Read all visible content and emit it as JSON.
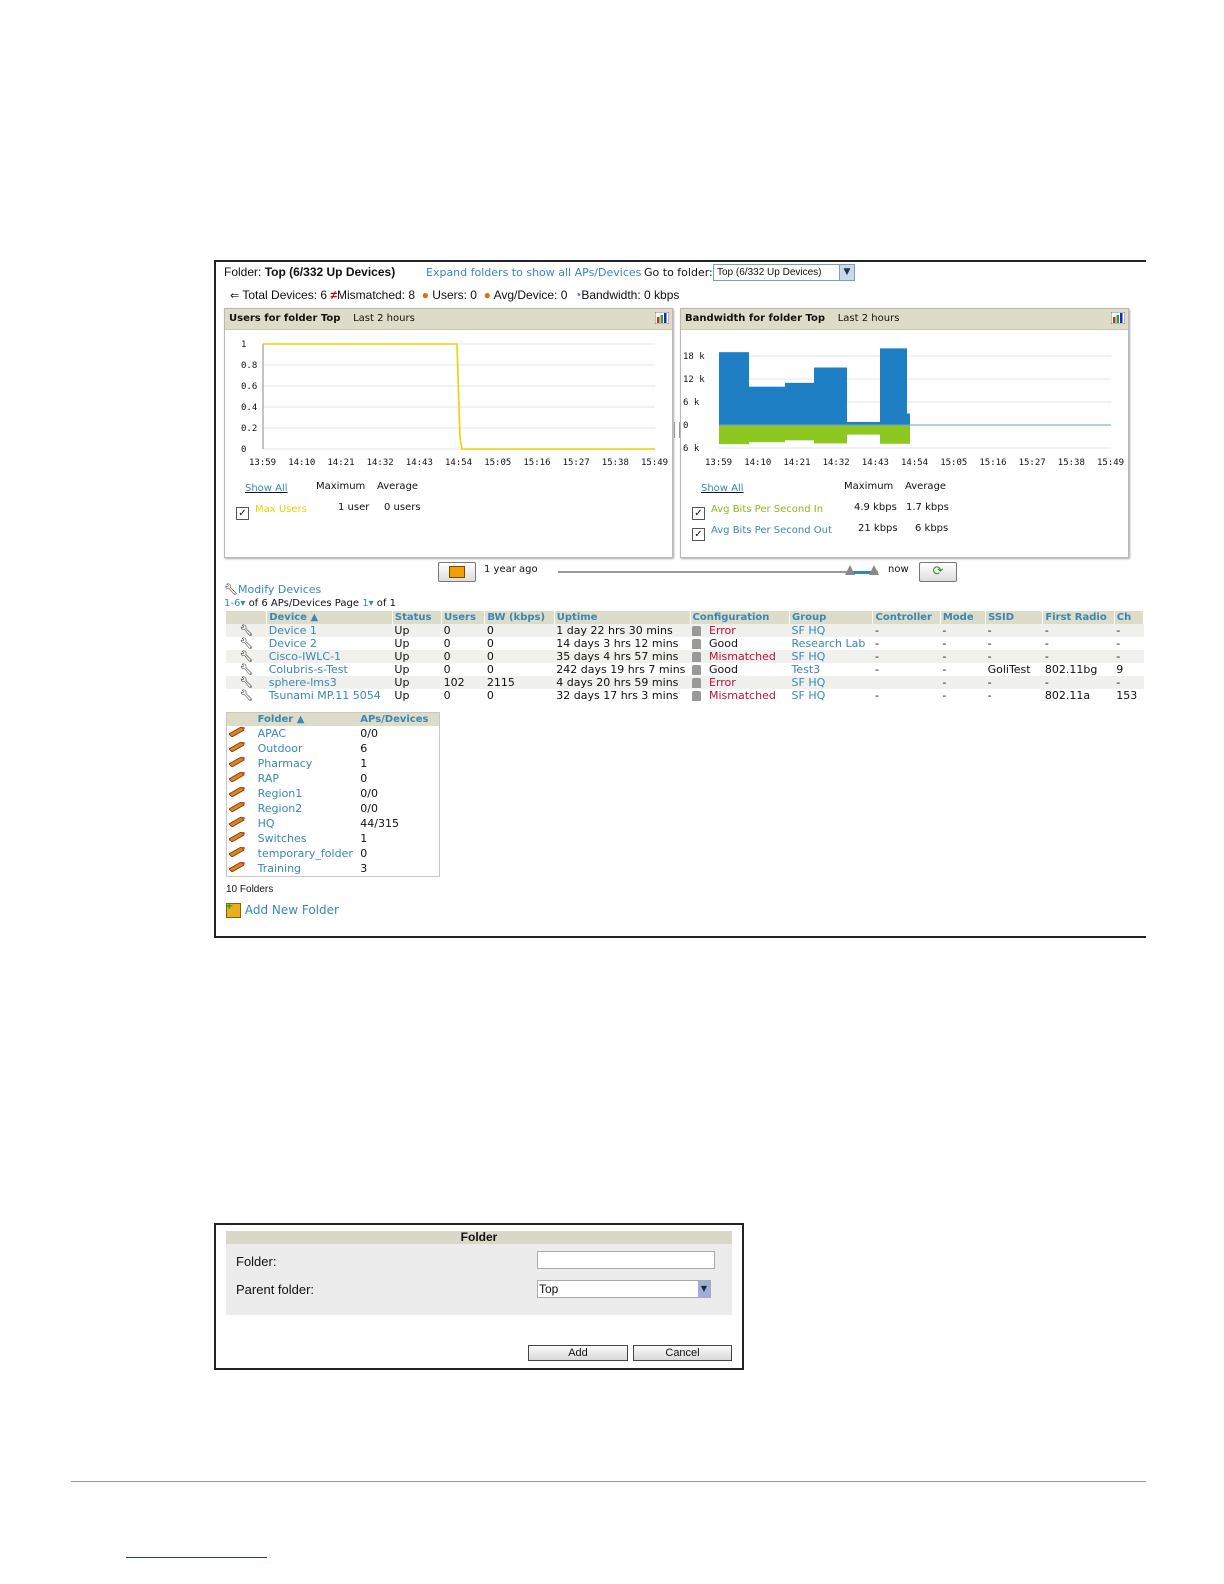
{
  "header": {
    "folder_label": "Folder:",
    "folder_value": "Top (6/332 Up Devices)",
    "expand_link": "Expand folders to show all APs/Devices",
    "goto_label": "Go to folder:",
    "goto_value": "Top (6/332 Up Devices)"
  },
  "stats": {
    "total_devices": "Total Devices: 6",
    "mismatched": "Mismatched: 8",
    "users": "Users: 0",
    "avg_device": "Avg/Device: 0",
    "bandwidth": "Bandwidth: 0 kbps"
  },
  "users_chart": {
    "title": "Users for folder Top",
    "range": "Last 2 hours",
    "show_all": "Show All",
    "col_max": "Maximum",
    "col_avg": "Average",
    "legend_label": "Max Users",
    "legend_max": "1 user",
    "legend_avg": "0 users",
    "yticks": [
      "1",
      "0.8",
      "0.6",
      "0.4",
      "0.2",
      "0"
    ],
    "xticks": [
      "13:59",
      "14:10",
      "14:21",
      "14:32",
      "14:43",
      "14:54",
      "15:05",
      "15:16",
      "15:27",
      "15:38",
      "15:49"
    ]
  },
  "bw_chart": {
    "title": "Bandwidth for folder Top",
    "range": "Last 2 hours",
    "show_all": "Show All",
    "col_max": "Maximum",
    "col_avg": "Average",
    "in_label": "Avg Bits Per Second In",
    "in_max": "4.9 kbps",
    "in_avg": "1.7 kbps",
    "out_label": "Avg Bits Per Second Out",
    "out_max": "21 kbps",
    "out_avg": "6 kbps",
    "yticks": [
      "18 k",
      "12 k",
      "6 k",
      "0",
      "6 k"
    ],
    "xticks": [
      "13:59",
      "14:10",
      "14:21",
      "14:32",
      "14:43",
      "14:54",
      "15:05",
      "15:16",
      "15:27",
      "15:38",
      "15:49"
    ]
  },
  "colors": {
    "link": "#3a87b7",
    "users_line": "#f0d000",
    "bw_in": "#1e7fc4",
    "bw_out": "#8cc820",
    "error": "#c0103c"
  },
  "timeline": {
    "left_label": "1 year ago",
    "right_label": "now"
  },
  "devices": {
    "modify_link": "Modify Devices",
    "range": "1-6",
    "of_text": "of 6 APs/Devices  Page",
    "page": "1",
    "of_pages": "of 1",
    "columns": [
      "Device ▲",
      "Status",
      "Users",
      "BW (kbps)",
      "Uptime",
      "Configuration",
      "Group",
      "Controller",
      "Mode",
      "SSID",
      "First Radio",
      "Ch"
    ],
    "rows": [
      {
        "device": "Device 1",
        "status": "Up",
        "users": "0",
        "bw": "0",
        "uptime": "1 day 22 hrs 30 mins",
        "config": "Error",
        "group": "SF HQ",
        "controller": "-",
        "mode": "-",
        "ssid": "-",
        "radio": "-",
        "ch": "-"
      },
      {
        "device": "Device 2",
        "status": "Up",
        "users": "0",
        "bw": "0",
        "uptime": "14 days 3 hrs 12 mins",
        "config": "Good",
        "group": "Research Lab",
        "controller": "-",
        "mode": "-",
        "ssid": "-",
        "radio": "-",
        "ch": "-"
      },
      {
        "device": "Cisco-IWLC-1",
        "status": "Up",
        "users": "0",
        "bw": "0",
        "uptime": "35 days 4 hrs 57 mins",
        "config": "Mismatched",
        "group": "SF HQ",
        "controller": "-",
        "mode": "-",
        "ssid": "-",
        "radio": "-",
        "ch": "-"
      },
      {
        "device": "Colubris-s-Test",
        "status": "Up",
        "users": "0",
        "bw": "0",
        "uptime": "242 days 19 hrs 7 mins",
        "config": "Good",
        "group": "Test3",
        "controller": "-",
        "mode": "-",
        "ssid": "GoliTest",
        "radio": "802.11bg",
        "ch": "9"
      },
      {
        "device": "sphere-lms3",
        "status": "Up",
        "users": "102",
        "bw": "2115",
        "uptime": "4 days 20 hrs 59 mins",
        "config": "Error",
        "group": "SF HQ",
        "controller": "",
        "mode": "-",
        "ssid": "-",
        "radio": "-",
        "ch": "-"
      },
      {
        "device": "Tsunami MP.11 5054",
        "status": "Up",
        "users": "0",
        "bw": "0",
        "uptime": "32 days 17 hrs 3 mins",
        "config": "Mismatched",
        "group": "SF HQ",
        "controller": "-",
        "mode": "-",
        "ssid": "-",
        "radio": "802.11a",
        "ch": "153"
      }
    ]
  },
  "folders": {
    "col_folder": "Folder ▲",
    "col_aps": "APs/Devices",
    "rows": [
      {
        "name": "APAC",
        "aps": "0/0"
      },
      {
        "name": "Outdoor",
        "aps": "6"
      },
      {
        "name": "Pharmacy",
        "aps": "1"
      },
      {
        "name": "RAP",
        "aps": "0"
      },
      {
        "name": "Region1",
        "aps": "0/0"
      },
      {
        "name": "Region2",
        "aps": "0/0"
      },
      {
        "name": "HQ",
        "aps": "44/315"
      },
      {
        "name": "Switches",
        "aps": "1"
      },
      {
        "name": "temporary_folder",
        "aps": "0"
      },
      {
        "name": "Training",
        "aps": "3"
      }
    ],
    "count": "10 Folders",
    "add_link": "Add New Folder"
  },
  "dialog": {
    "title": "Folder",
    "folder_label": "Folder:",
    "folder_value": "",
    "parent_label": "Parent folder:",
    "parent_value": "Top",
    "add_button": "Add",
    "cancel_button": "Cancel"
  }
}
